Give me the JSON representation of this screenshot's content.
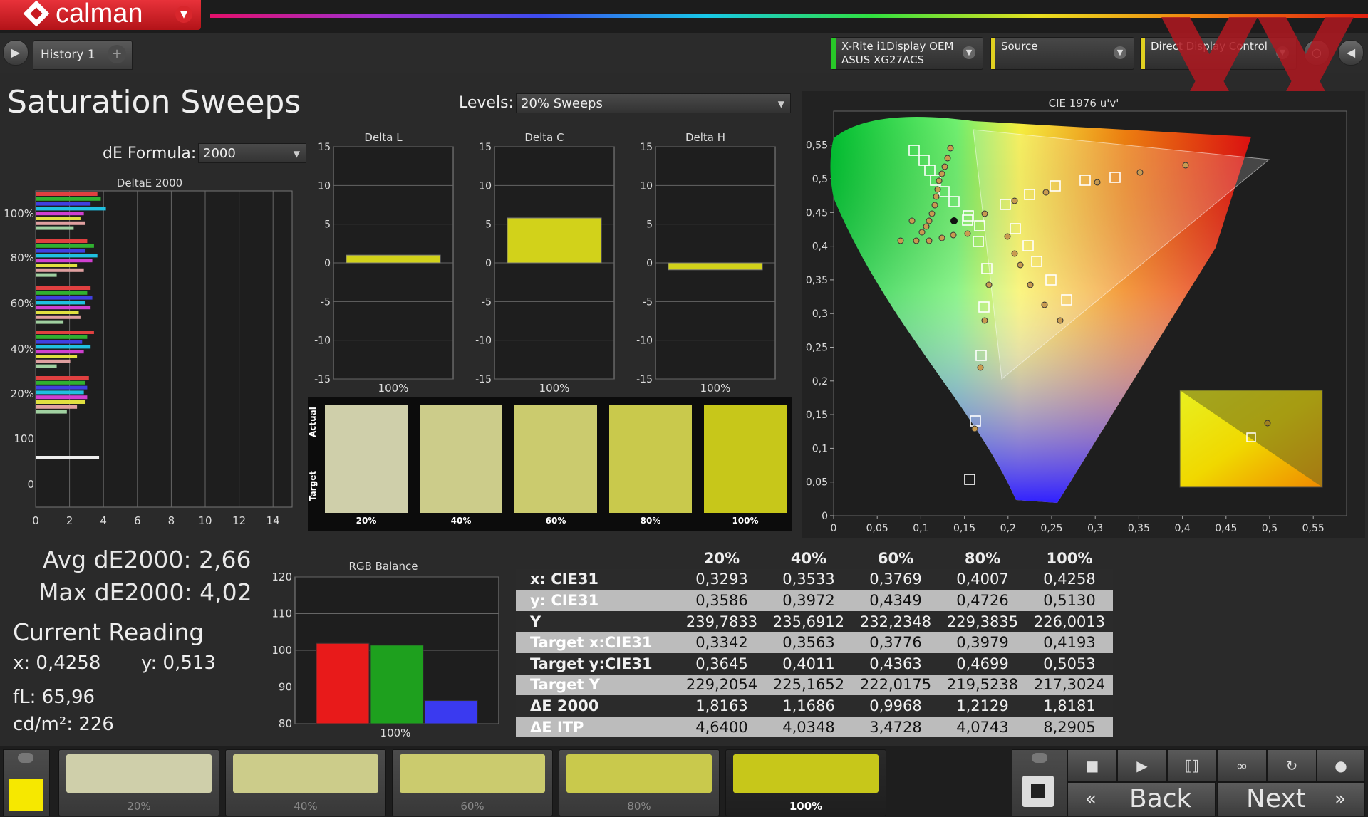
{
  "app": {
    "logo_text": "calman"
  },
  "tabs": {
    "history_tab": "History 1",
    "add_tab": "+"
  },
  "devices": {
    "meter_line1": "X-Rite i1Display OEM",
    "meter_line2": "ASUS XG27ACS",
    "source": "Source",
    "direct": "Direct Display Control"
  },
  "page": {
    "title": "Saturation Sweeps",
    "levels_label": "Levels:",
    "levels_value": "20% Sweeps",
    "de_label": "dE Formula:",
    "de_value": "2000"
  },
  "deltae_chart": {
    "title": "DeltaE 2000",
    "row_labels": [
      "100%",
      "80%",
      "60%",
      "40%",
      "20%",
      "100",
      "0"
    ],
    "x_ticks": [
      "0",
      "2",
      "4",
      "6",
      "8",
      "10",
      "12",
      "14"
    ]
  },
  "delta_charts": [
    {
      "title": "Delta L",
      "value": 1.0,
      "label": "100%",
      "y_ticks": [
        "15",
        "10",
        "5",
        "0",
        "-5",
        "-10",
        "-15"
      ]
    },
    {
      "title": "Delta C",
      "value": 5.8,
      "label": "100%",
      "y_ticks": [
        "15",
        "10",
        "5",
        "0",
        "-5",
        "-10",
        "-15"
      ]
    },
    {
      "title": "Delta H",
      "value": -0.9,
      "label": "100%",
      "y_ticks": [
        "15",
        "10",
        "5",
        "0",
        "-5",
        "-10",
        "-15"
      ]
    }
  ],
  "swatch_panel": {
    "actual_label": "Actual",
    "target_label": "Target",
    "labels": [
      "20%",
      "40%",
      "60%",
      "80%",
      "100%"
    ],
    "colors": [
      "#cfcfaa",
      "#cccc8a",
      "#cbcb6e",
      "#c9c94c",
      "#c7c71a"
    ]
  },
  "cie": {
    "title": "CIE 1976 u'v'",
    "x_ticks": [
      "0",
      "0,05",
      "0,1",
      "0,15",
      "0,2",
      "0,25",
      "0,3",
      "0,35",
      "0,4",
      "0,45",
      "0,5",
      "0,55"
    ],
    "y_ticks": [
      "0",
      "0,05",
      "0,1",
      "0,15",
      "0,2",
      "0,25",
      "0,3",
      "0,35",
      "0,4",
      "0,45",
      "0,5",
      "0,55"
    ]
  },
  "stats": {
    "avg": "Avg dE2000: 2,66",
    "max": "Max dE2000: 4,02",
    "current_heading": "Current Reading",
    "x": "x: 0,4258",
    "y": "y: 0,513",
    "fl": "fL: 65,96",
    "cdm2": "cd/m²: 226"
  },
  "rgb_balance": {
    "title": "RGB Balance",
    "y_ticks": [
      "120",
      "110",
      "100",
      "90",
      "80"
    ],
    "label": "100%",
    "chart_data": {
      "type": "bar",
      "categories": [
        "R",
        "G",
        "B"
      ],
      "values": [
        101.9,
        101.4,
        86.3
      ],
      "ylim": [
        80,
        120
      ],
      "colors": [
        "#e81a1a",
        "#1ea01e",
        "#3a3af0"
      ]
    }
  },
  "table": {
    "headers": [
      "",
      "20%",
      "40%",
      "60%",
      "80%",
      "100%"
    ],
    "rows": [
      {
        "label": "x: CIE31",
        "values": [
          "0,3293",
          "0,3533",
          "0,3769",
          "0,4007",
          "0,4258"
        ]
      },
      {
        "label": "y: CIE31",
        "values": [
          "0,3586",
          "0,3972",
          "0,4349",
          "0,4726",
          "0,5130"
        ]
      },
      {
        "label": "Y",
        "values": [
          "239,7833",
          "235,6912",
          "232,2348",
          "229,3835",
          "226,0013"
        ]
      },
      {
        "label": "Target x:CIE31",
        "values": [
          "0,3342",
          "0,3563",
          "0,3776",
          "0,3979",
          "0,4193"
        ]
      },
      {
        "label": "Target y:CIE31",
        "values": [
          "0,3645",
          "0,4011",
          "0,4363",
          "0,4699",
          "0,5053"
        ]
      },
      {
        "label": "Target Y",
        "values": [
          "229,2054",
          "225,1652",
          "222,0175",
          "219,5238",
          "217,3024"
        ]
      },
      {
        "label": "ΔE 2000",
        "values": [
          "1,8163",
          "1,1686",
          "0,9968",
          "1,2129",
          "1,8181"
        ]
      },
      {
        "label": "ΔE ITP",
        "values": [
          "4,6400",
          "4,0348",
          "3,4728",
          "4,0743",
          "8,2905"
        ]
      }
    ]
  },
  "bottom": {
    "patches": [
      "20%",
      "40%",
      "60%",
      "80%",
      "100%"
    ],
    "current_color": "#f6e800",
    "back": "Back",
    "next": "Next"
  }
}
